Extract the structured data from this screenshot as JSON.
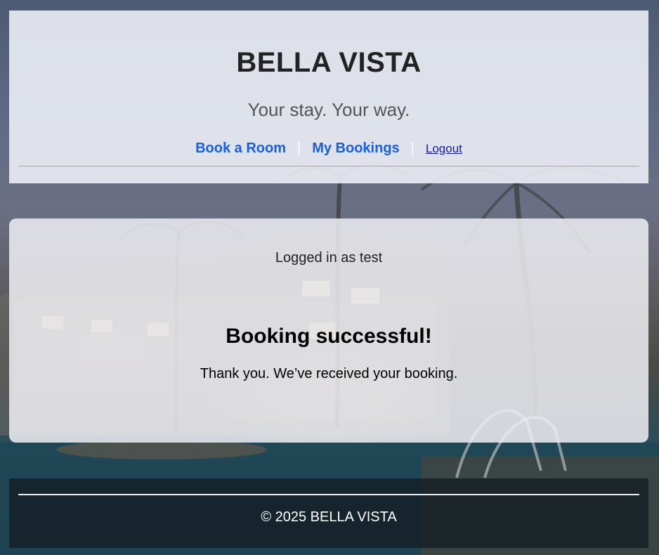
{
  "header": {
    "title": "BELLA VISTA",
    "tagline": "Your stay. Your way.",
    "nav": {
      "book_room": "Book a Room",
      "separator_1": "|",
      "my_bookings": "My Bookings",
      "separator_2": "|",
      "logout": "Logout"
    }
  },
  "main": {
    "logged_in_text": "Logged in as test",
    "heading": "Booking successful!",
    "message": "Thank you. We’ve received your booking."
  },
  "footer": {
    "copyright": "© 2025 BELLA VISTA"
  },
  "colors": {
    "nav_link": "#1560e6",
    "logout_link": "#1a1aa6",
    "title_text": "#222222",
    "footer_bg": "#141c22"
  },
  "background": "resort pool with palm trees at dusk"
}
